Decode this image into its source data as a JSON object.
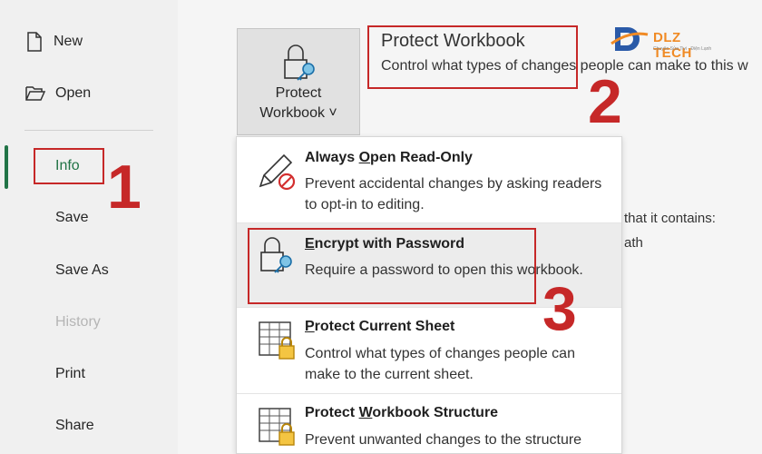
{
  "sidebar": {
    "items": [
      {
        "label": "New"
      },
      {
        "label": "Open"
      },
      {
        "label": "Info"
      },
      {
        "label": "Save"
      },
      {
        "label": "Save As"
      },
      {
        "label": "History"
      },
      {
        "label": "Print"
      },
      {
        "label": "Share"
      }
    ]
  },
  "protect_button": {
    "line1": "Protect",
    "line2": "Workbook ˅"
  },
  "protect_panel": {
    "title": "Protect Workbook",
    "description": "Control what types of changes people can make to this w"
  },
  "background_text": {
    "line1": "that it contains:",
    "line2": "ath"
  },
  "logo": {
    "text": "DLZ TECH",
    "tagline": "Chuyên Sửa Tivi - Điện Lạnh"
  },
  "annotations": {
    "n1": "1",
    "n2": "2",
    "n3": "3"
  },
  "menu": {
    "items": [
      {
        "title_pre": "Always ",
        "title_key": "O",
        "title_post": "pen Read-Only",
        "desc": "Prevent accidental changes by asking readers to opt-in to editing."
      },
      {
        "title_pre": "",
        "title_key": "E",
        "title_post": "ncrypt with Password",
        "desc": "Require a password to open this workbook."
      },
      {
        "title_pre": "",
        "title_key": "P",
        "title_post": "rotect Current Sheet",
        "desc": "Control what types of changes people can make to the current sheet."
      },
      {
        "title_pre": "Protect ",
        "title_key": "W",
        "title_post": "orkbook Structure",
        "desc": "Prevent unwanted changes to the structure"
      }
    ]
  },
  "colors": {
    "accent_green": "#217346",
    "annotation_red": "#c62828",
    "logo_orange": "#f08a24"
  }
}
